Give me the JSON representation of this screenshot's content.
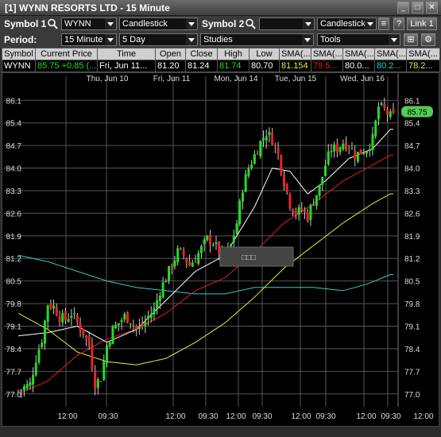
{
  "window": {
    "title": "[1] WYNN RESORTS LTD - 15 Minute"
  },
  "toolbar1": {
    "symbol1_label": "Symbol 1:",
    "symbol1_value": "WYNN",
    "chart_type1": "Candlestick",
    "symbol2_label": "Symbol 2:",
    "symbol2_value": "",
    "chart_type2": "Candlestick",
    "link_label": "Link 1"
  },
  "toolbar2": {
    "period_label": "Period:",
    "interval": "15 Minute",
    "range": "5 Day",
    "studies": "Studies",
    "tools": "Tools"
  },
  "quote_table": {
    "headers": [
      "Symbol",
      "Current Price",
      "Time",
      "Open",
      "Close",
      "High",
      "Low",
      "SMA(...",
      "SMA(...",
      "SMA(...",
      "SMA(...",
      "SMA(..."
    ],
    "row": {
      "symbol": "WYNN",
      "current_price": "85.75",
      "change": "+0.85 (...",
      "time": "Fri, Jun 11...",
      "open": "81.20",
      "close": "81.24",
      "high": "81.74",
      "low": "80.70",
      "sma1": "81.154",
      "sma2": "79.5...",
      "sma3": "80.0...",
      "sma4": "80.2...",
      "sma5": "78.2..."
    }
  },
  "colors": {
    "up": "#22dd22",
    "down": "#ee2222",
    "sma_white": "#ffffff",
    "sma_red": "#dd2222",
    "sma_yellow": "#e8e83a",
    "sma_cyan": "#33cccc",
    "price_badge": "#55cc55"
  },
  "chart_data": {
    "type": "candlestick",
    "date_labels": [
      "Thu, Jun 10",
      "Fri, Jun 11",
      "Mon, Jun 14",
      "Tue, Jun 15",
      "Wed, Jun 16"
    ],
    "time_labels": [
      "12:00",
      "09:30",
      "12:00",
      "09:30",
      "12:00",
      "09:30",
      "12:00",
      "09:30",
      "12:00",
      "09:30",
      "12:00"
    ],
    "y_ticks": [
      "86.1",
      "85.4",
      "84.7",
      "84.0",
      "83.3",
      "82.6",
      "81.9",
      "81.2",
      "80.5",
      "79.8",
      "79.1",
      "78.4",
      "77.7",
      "77.0"
    ],
    "ylim": [
      76.6,
      86.6
    ],
    "current_price_label": "85.75",
    "tooltip_text": "□□□",
    "close_path": [
      [
        0,
        77.1
      ],
      [
        4,
        77.3
      ],
      [
        6,
        78.1
      ],
      [
        8,
        78.7
      ],
      [
        10,
        79.8
      ],
      [
        12,
        79.7
      ],
      [
        14,
        79.4
      ],
      [
        16,
        79.3
      ],
      [
        18,
        79.5
      ],
      [
        20,
        79.2
      ],
      [
        22,
        78.9
      ],
      [
        24,
        78.5
      ],
      [
        25,
        77.9
      ],
      [
        26,
        77.3
      ],
      [
        28,
        77.5
      ],
      [
        30,
        78.5
      ],
      [
        32,
        79.0
      ],
      [
        34,
        79.2
      ],
      [
        36,
        79.4
      ],
      [
        38,
        79.3
      ],
      [
        40,
        79.0
      ],
      [
        42,
        79.1
      ],
      [
        44,
        79.4
      ],
      [
        46,
        79.6
      ],
      [
        48,
        80.2
      ],
      [
        50,
        80.6
      ],
      [
        52,
        81.0
      ],
      [
        54,
        81.4
      ],
      [
        56,
        81.3
      ],
      [
        58,
        81.0
      ],
      [
        60,
        81.2
      ],
      [
        62,
        81.5
      ],
      [
        64,
        81.8
      ],
      [
        66,
        81.7
      ],
      [
        68,
        81.4
      ],
      [
        70,
        81.3
      ],
      [
        72,
        81.6
      ],
      [
        74,
        82.3
      ],
      [
        76,
        83.4
      ],
      [
        78,
        84.0
      ],
      [
        80,
        84.4
      ],
      [
        82,
        84.8
      ],
      [
        84,
        85.1
      ],
      [
        86,
        84.9
      ],
      [
        88,
        84.4
      ],
      [
        90,
        83.6
      ],
      [
        92,
        82.9
      ],
      [
        94,
        82.6
      ],
      [
        96,
        82.7
      ],
      [
        98,
        82.5
      ],
      [
        100,
        83.0
      ],
      [
        102,
        83.4
      ],
      [
        104,
        84.1
      ],
      [
        106,
        84.6
      ],
      [
        108,
        84.6
      ],
      [
        110,
        84.8
      ],
      [
        112,
        84.7
      ],
      [
        114,
        84.4
      ],
      [
        116,
        84.5
      ],
      [
        118,
        84.6
      ],
      [
        120,
        84.9
      ],
      [
        122,
        85.9
      ],
      [
        124,
        85.8
      ],
      [
        126,
        85.6
      ]
    ],
    "sma_white": [
      [
        0,
        78.8
      ],
      [
        10,
        78.9
      ],
      [
        20,
        79.1
      ],
      [
        30,
        78.6
      ],
      [
        40,
        79.0
      ],
      [
        50,
        79.9
      ],
      [
        60,
        80.8
      ],
      [
        70,
        81.3
      ],
      [
        80,
        82.8
      ],
      [
        86,
        84.0
      ],
      [
        92,
        83.9
      ],
      [
        98,
        83.2
      ],
      [
        104,
        83.6
      ],
      [
        112,
        84.3
      ],
      [
        120,
        84.6
      ],
      [
        126,
        85.2
      ]
    ],
    "sma_red": [
      [
        0,
        77.0
      ],
      [
        10,
        77.4
      ],
      [
        20,
        78.2
      ],
      [
        30,
        78.7
      ],
      [
        40,
        79.0
      ],
      [
        50,
        79.5
      ],
      [
        60,
        80.2
      ],
      [
        70,
        80.6
      ],
      [
        80,
        81.4
      ],
      [
        90,
        82.3
      ],
      [
        100,
        82.9
      ],
      [
        110,
        83.6
      ],
      [
        120,
        84.1
      ],
      [
        126,
        84.4
      ]
    ],
    "sma_yellow": [
      [
        0,
        79.5
      ],
      [
        10,
        79.0
      ],
      [
        20,
        78.3
      ],
      [
        30,
        78.0
      ],
      [
        40,
        77.9
      ],
      [
        50,
        78.1
      ],
      [
        60,
        78.6
      ],
      [
        70,
        79.2
      ],
      [
        80,
        80.0
      ],
      [
        90,
        80.9
      ],
      [
        100,
        81.6
      ],
      [
        110,
        82.3
      ],
      [
        120,
        82.9
      ],
      [
        126,
        83.2
      ]
    ],
    "sma_cyan": [
      [
        0,
        81.3
      ],
      [
        10,
        81.1
      ],
      [
        20,
        80.8
      ],
      [
        30,
        80.5
      ],
      [
        40,
        80.3
      ],
      [
        50,
        80.2
      ],
      [
        60,
        80.1
      ],
      [
        70,
        80.1
      ],
      [
        80,
        80.3
      ],
      [
        90,
        80.3
      ],
      [
        100,
        80.3
      ],
      [
        110,
        80.2
      ],
      [
        118,
        80.4
      ],
      [
        126,
        80.7
      ]
    ]
  }
}
